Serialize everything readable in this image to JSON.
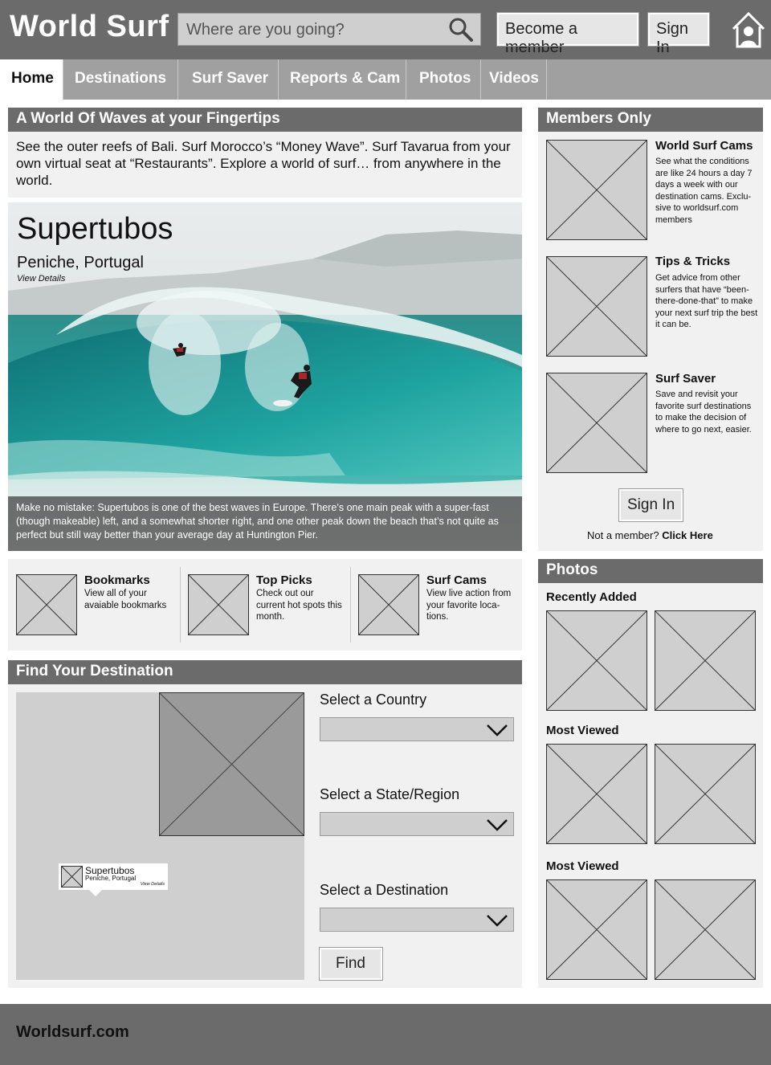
{
  "header": {
    "logo": "World Surf",
    "search_placeholder": "Where are you going?",
    "become_member": "Become a member",
    "sign_in": "Sign In"
  },
  "nav": {
    "items": [
      {
        "label": "Home",
        "active": true
      },
      {
        "label": "Destinations"
      },
      {
        "label": "Surf Saver"
      },
      {
        "label": "Reports & Cam"
      },
      {
        "label": "Photos"
      },
      {
        "label": "Videos"
      }
    ]
  },
  "intro": {
    "title": "A World Of Waves at your Fingertips",
    "text": "See the outer reefs of Bali. Surf Morocco’s “Money Wave”. Surf Tavarua from your own virtual seat at “Restaurants”. Explore a world of surf… from anywhere in the world."
  },
  "hero": {
    "title": "Supertubos",
    "location": "Peniche, Portugal",
    "link": "View Details",
    "caption": "Make no mistake: Supertubos is one of the best waves in Europe. There’s one main peak with a super-fast (though makeable) left, and a somewhat shorter right, and one other peak down the beach that’s not quite as perfect but still way better than your average day at Huntington Pier."
  },
  "features": [
    {
      "title": "Bookmarks",
      "desc": "View all of your avaiable bookmarks"
    },
    {
      "title": "Top Picks",
      "desc": "Check out our current hot spots this month."
    },
    {
      "title": "Surf Cams",
      "desc": "View live action from your favorite loca-tions."
    }
  ],
  "find": {
    "title": "Find Your Destination",
    "country_label": "Select a Country",
    "state_label": "Select a State/Region",
    "destination_label": "Select a Destination",
    "find_button": "Find",
    "map_pin": {
      "title": "Supertubos",
      "sub": "Peniche, Portugal",
      "link": "View Details"
    }
  },
  "members": {
    "title": "Members Only",
    "items": [
      {
        "title": "World Surf Cams",
        "desc": "See what the conditions are like 24 hours a day 7 days a week with our destination cams. Exclu-sive to worldsurf.com members"
      },
      {
        "title": "Tips & Tricks",
        "desc": "Get advice from other surfers that have “been-there-done-that” to make your next surf trip the best it can be."
      },
      {
        "title": "Surf Saver",
        "desc": "Save and revisit your favorite surf destinations to make the decision of where to go next, easier."
      }
    ],
    "sign_in": "Sign In",
    "not_member": "Not a member?",
    "click_here": "Click Here"
  },
  "photos": {
    "title": "Photos",
    "sections": [
      "Recently Added",
      "Most Viewed",
      "Most Viewed"
    ]
  },
  "footer": {
    "text": "Worldsurf.com"
  }
}
